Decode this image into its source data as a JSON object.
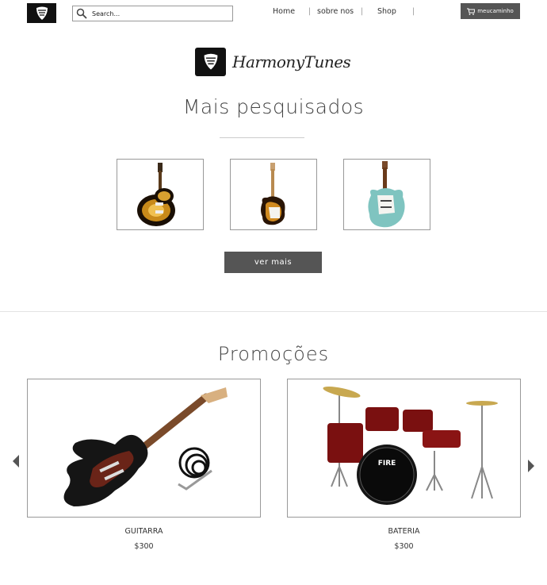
{
  "header": {
    "search_placeholder": "Search...",
    "nav": [
      "Home",
      "sobre nos",
      "Shop"
    ],
    "cart_label": "meucaminho"
  },
  "brand": {
    "name": "HarmonyTunes"
  },
  "popular": {
    "title": "Mais pesquisados",
    "items": [
      "les-paul-sunburst-guitar",
      "stratocaster-sunburst-guitar",
      "stratocaster-seafoam-guitar"
    ],
    "more_button": "ver mais"
  },
  "promos": {
    "title": "Promoções",
    "items": [
      {
        "name": "GUITARRA",
        "price": "$300"
      },
      {
        "name": "BATERIA",
        "price": "$300"
      }
    ]
  },
  "colors": {
    "dark_button": "#555555",
    "logo_bg": "#111111"
  }
}
